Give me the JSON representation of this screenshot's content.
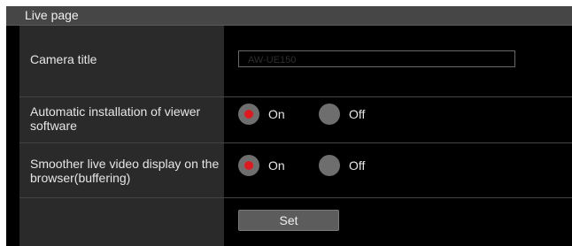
{
  "section": {
    "title": "Live page"
  },
  "camera_title": {
    "label": "Camera title",
    "value": "AW-UE150"
  },
  "auto_install": {
    "label": "Automatic installation of viewer software",
    "options": [
      {
        "label": "On",
        "checked": true
      },
      {
        "label": "Off",
        "checked": false
      }
    ]
  },
  "smoother_live": {
    "label": "Smoother live video display on the browser(buffering)",
    "options": [
      {
        "label": "On",
        "checked": true
      },
      {
        "label": "Off",
        "checked": false
      }
    ]
  },
  "actions": {
    "set_label": "Set"
  },
  "colors": {
    "radio_selected": "#e0181e",
    "panel_bg": "#000000",
    "label_bg": "#2a2a2a",
    "header_bg": "#464646"
  }
}
